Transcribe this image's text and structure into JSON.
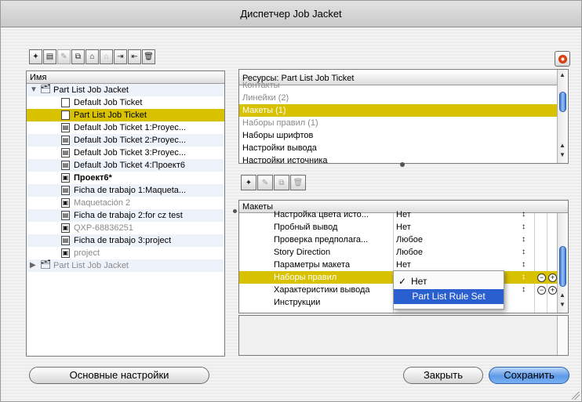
{
  "window": {
    "title": "Диспетчер Job Jacket"
  },
  "toolbar": {
    "icons": [
      "new-jacket-icon",
      "new-ticket-icon",
      "edit-icon",
      "duplicate-icon",
      "open-icon",
      "open-disabled-icon",
      "import-icon",
      "export-icon",
      "delete-icon"
    ]
  },
  "tree": {
    "header": "Имя",
    "rows": [
      {
        "label": "Part List Job Jacket",
        "kind": "jacket",
        "indent": 0,
        "expanded": true
      },
      {
        "label": "Default Job Ticket",
        "kind": "ticket",
        "indent": 1
      },
      {
        "label": "Part List Job Ticket",
        "kind": "ticket",
        "indent": 1,
        "selected": true
      },
      {
        "label": "Default Job Ticket 1:Proyec...",
        "kind": "doc",
        "indent": 1
      },
      {
        "label": "Default Job Ticket 2:Proyec...",
        "kind": "doc",
        "indent": 1
      },
      {
        "label": "Default Job Ticket 3:Proyec...",
        "kind": "doc",
        "indent": 1
      },
      {
        "label": "Default Job Ticket 4:Проект6",
        "kind": "doc",
        "indent": 1
      },
      {
        "label": "Проект6*",
        "kind": "project",
        "indent": 1,
        "bold": true
      },
      {
        "label": "Ficha de trabajo 1:Maqueta...",
        "kind": "doc",
        "indent": 1
      },
      {
        "label": "Maquetación 2",
        "kind": "project",
        "indent": 1,
        "grey": true
      },
      {
        "label": "Ficha de trabajo 2:for cz test",
        "kind": "doc",
        "indent": 1
      },
      {
        "label": "QXP-68836251",
        "kind": "project",
        "indent": 1,
        "grey": true
      },
      {
        "label": "Ficha de trabajo 3:project",
        "kind": "doc",
        "indent": 1
      },
      {
        "label": "project",
        "kind": "project",
        "indent": 1,
        "grey": true
      },
      {
        "label": "Part List Job Jacket",
        "kind": "jacket",
        "indent": 0,
        "grey": true,
        "expanded": false
      }
    ]
  },
  "resources": {
    "header": "Ресурсы: Part List Job Ticket",
    "items": [
      {
        "label": "Контакты",
        "grey": true
      },
      {
        "label": "Линейки (2)",
        "grey": true
      },
      {
        "label": "Макеты (1)",
        "selected": true
      },
      {
        "label": "Наборы правил (1)",
        "grey": true
      },
      {
        "label": "Наборы шрифтов"
      },
      {
        "label": "Настройки вывода"
      },
      {
        "label": "Настройки источника"
      }
    ]
  },
  "layout_toolbar": {
    "icons": [
      "new-layout-icon",
      "edit-layout-icon",
      "duplicate-layout-icon",
      "delete-layout-icon"
    ]
  },
  "layouts": {
    "header": "Макеты",
    "rows": [
      {
        "name": "Настройка цвета исто...",
        "value": "Нет"
      },
      {
        "name": "Пробный вывод",
        "value": "Нет"
      },
      {
        "name": "Проверка предполага...",
        "value": "Любое"
      },
      {
        "name": "Story Direction",
        "value": "Любое"
      },
      {
        "name": "Параметры макета",
        "value": "Нет"
      },
      {
        "name": "Наборы правил",
        "value": "",
        "selected": true,
        "pm": true
      },
      {
        "name": "Характеристики вывода",
        "value": "",
        "pm": true
      },
      {
        "name": "Инструкции",
        "value": ""
      }
    ],
    "updown": "↕"
  },
  "popup": {
    "items": [
      {
        "label": "Нет",
        "checked": true
      },
      {
        "label": "Part List Rule Set",
        "highlighted": true
      }
    ],
    "check": "✓"
  },
  "buttons": {
    "defaults": "Основные настройки",
    "close": "Закрыть",
    "save": "Сохранить"
  }
}
